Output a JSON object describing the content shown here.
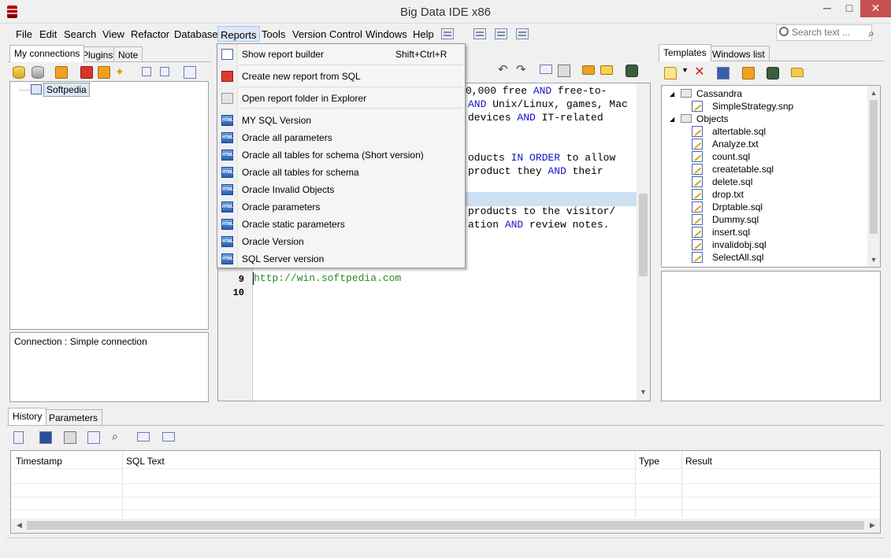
{
  "window": {
    "title": "Big Data IDE x86",
    "minimize": "─",
    "maximize": "□",
    "close": "✕"
  },
  "menubar": {
    "items": [
      "File",
      "Edit",
      "Search",
      "View",
      "Refactor",
      "Database",
      "Reports",
      "Tools",
      "Version Control",
      "Windows",
      "Help"
    ],
    "active": "Reports"
  },
  "search": {
    "placeholder": "Search text ..."
  },
  "left_panel": {
    "tabs": [
      "My connections",
      "Plugins",
      "Note"
    ],
    "tree_root": "Softpedia",
    "connection_info": "Connection : Simple connection"
  },
  "reports_menu": {
    "items": [
      {
        "label": "Show report builder",
        "shortcut": "Shift+Ctrl+R",
        "icon": "report-builder-icon"
      },
      {
        "label": "Create new report from SQL",
        "shortcut": "",
        "icon": "new-report-icon"
      },
      {
        "label": "Open report folder in Explorer",
        "shortcut": "",
        "icon": "folder-icon"
      },
      {
        "label": "MY SQL Version",
        "icon": "html-icon"
      },
      {
        "label": "Oracle all parameters",
        "icon": "html-icon"
      },
      {
        "label": "Oracle all tables for schema (Short version)",
        "icon": "html-icon"
      },
      {
        "label": "Oracle all tables for schema",
        "icon": "html-icon"
      },
      {
        "label": "Oracle Invalid Objects",
        "icon": "html-icon"
      },
      {
        "label": "Oracle parameters",
        "icon": "html-icon"
      },
      {
        "label": "Oracle static parameters",
        "icon": "html-icon"
      },
      {
        "label": "Oracle Version",
        "icon": "html-icon"
      },
      {
        "label": "SQL Server version",
        "icon": "html-icon"
      }
    ]
  },
  "editor": {
    "lines": [
      {
        "parts": [
          [
            "",
            "0,000 free "
          ],
          [
            "kw",
            "AND"
          ],
          [
            "",
            " free-to-"
          ]
        ]
      },
      {
        "parts": [
          [
            "kw",
            "AND"
          ],
          [
            "",
            " Unix/Linux, games, Mac"
          ]
        ]
      },
      {
        "parts": [
          [
            "",
            "devices "
          ],
          [
            "kw",
            "AND"
          ],
          [
            "",
            " IT-related"
          ]
        ]
      },
      {
        "parts": [
          [
            "",
            ""
          ]
        ]
      },
      {
        "parts": [
          [
            "",
            "oducts "
          ],
          [
            "kw",
            "IN ORDER"
          ],
          [
            "",
            " to allow"
          ]
        ]
      },
      {
        "parts": [
          [
            "",
            "product they "
          ],
          [
            "kw",
            "AND"
          ],
          [
            "",
            " their"
          ]
        ]
      },
      {
        "parts": [
          [
            "",
            ""
          ]
        ]
      },
      {
        "parts": [
          [
            "",
            "products to the visitor/"
          ]
        ]
      },
      {
        "parts": [
          [
            "",
            "ation "
          ],
          [
            "kw",
            "AND"
          ],
          [
            "",
            " review notes."
          ]
        ]
      }
    ],
    "line9": {
      "number": "9",
      "text": "http://win.softpedia.com"
    },
    "line10": {
      "number": "10"
    }
  },
  "right_panel": {
    "tabs": [
      "Templates",
      "Windows list"
    ],
    "tree": {
      "cassandra": "Cassandra",
      "cassandra_children": [
        "SimpleStrategy.snp"
      ],
      "objects": "Objects",
      "objects_children": [
        "altertable.sql",
        "Analyze.txt",
        "count.sql",
        "createtable.sql",
        "delete.sql",
        "drop.txt",
        "Drptable.sql",
        "Dummy.sql",
        "insert.sql",
        "invalidobj.sql",
        "SelectAll.sql"
      ]
    }
  },
  "bottom_panel": {
    "tabs": [
      "History",
      "Parameters"
    ],
    "columns": [
      "Timestamp",
      "SQL Text",
      "Type",
      "Result"
    ]
  }
}
